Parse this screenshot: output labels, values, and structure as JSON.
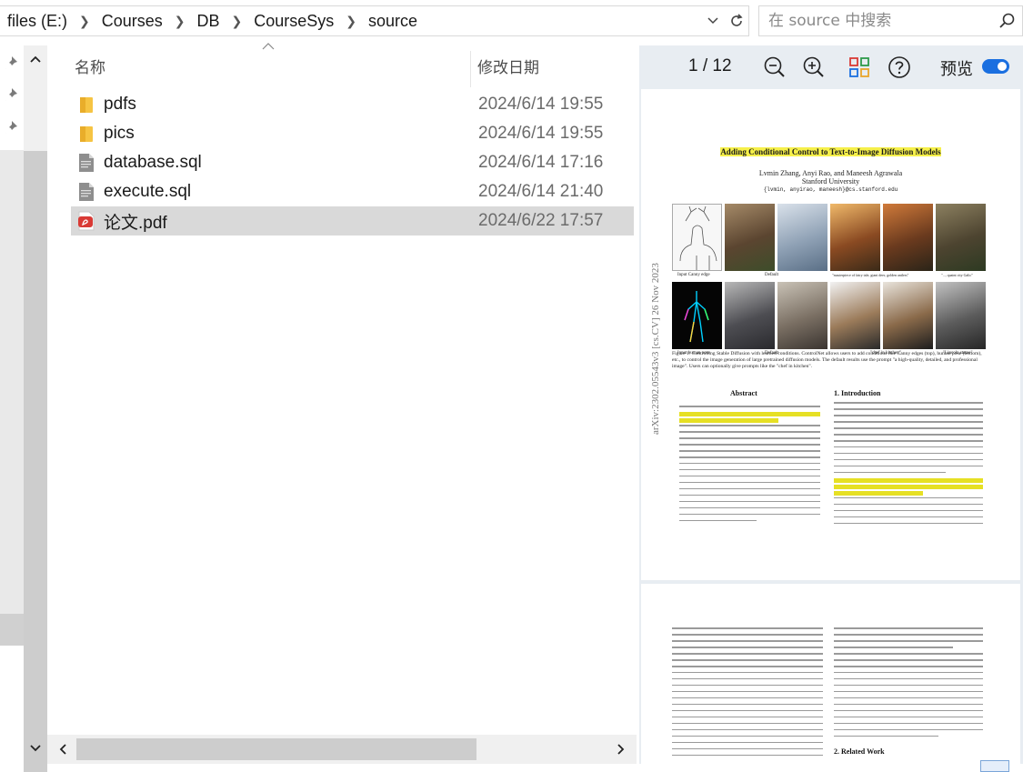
{
  "address_bar": {
    "crumbs": [
      "files (E:)",
      "Courses",
      "DB",
      "CourseSys",
      "source"
    ]
  },
  "search": {
    "placeholder": "在 source 中搜索"
  },
  "columns": {
    "name": "名称",
    "date_modified": "修改日期"
  },
  "files": [
    {
      "name": "pdfs",
      "date": "2024/6/14 19:55",
      "icon": "folder-icon",
      "selected": false
    },
    {
      "name": "pics",
      "date": "2024/6/14 19:55",
      "icon": "folder-icon",
      "selected": false
    },
    {
      "name": "database.sql",
      "date": "2024/6/14 17:16",
      "icon": "sql-file-icon",
      "selected": false
    },
    {
      "name": "execute.sql",
      "date": "2024/6/14 21:40",
      "icon": "sql-file-icon",
      "selected": false
    },
    {
      "name": "论文.pdf",
      "date": "2024/6/22 17:57",
      "icon": "pdf-file-icon",
      "selected": true
    }
  ],
  "preview": {
    "page_indicator": "1 / 12",
    "preview_label": "预览",
    "preview_toggle_on": true,
    "paper": {
      "title": "Adding Conditional Control to Text-to-Image Diffusion Models",
      "authors": "Lvmin Zhang, Anyi Rao, and Maneesh Agrawala",
      "affiliation": "Stanford University",
      "emails": "{lvmin, anyirao, maneesh}@cs.stanford.edu",
      "arxiv_id": "arXiv:2302.05543v3  [cs.CV]  26 Nov 2023",
      "fig_captions_row1": [
        "Input Canny edge",
        "Default",
        "\"masterpiece of fairy tale, giant deer, golden antlers\"",
        "\"..., quaint city Galic\""
      ],
      "fig_captions_row2": [
        "Input human pose",
        "Default",
        "\"chef in kitchen\"",
        "\"Lincoln statue\""
      ],
      "figure_caption": "Figure 1: Controlling Stable Diffusion with learned conditions. ControlNet allows users to add conditions like Canny edges (top), human pose (bottom), etc., to control the image generation of large pretrained diffusion models. The default results use the prompt \"a high-quality, detailed, and professional image\". Users can optionally give prompts like the \"chef in kitchen\".",
      "abstract_heading": "Abstract",
      "intro_heading": "1. Introduction",
      "related_heading": "2. Related Work"
    }
  },
  "colors": {
    "selected_row": "#d9d9d9",
    "preview_bg": "#e8edf2",
    "toggle_accent": "#1a6fe0",
    "highlight": "#f6f04a",
    "folder": "#f6c443",
    "pdf_icon": "#d93a35"
  }
}
